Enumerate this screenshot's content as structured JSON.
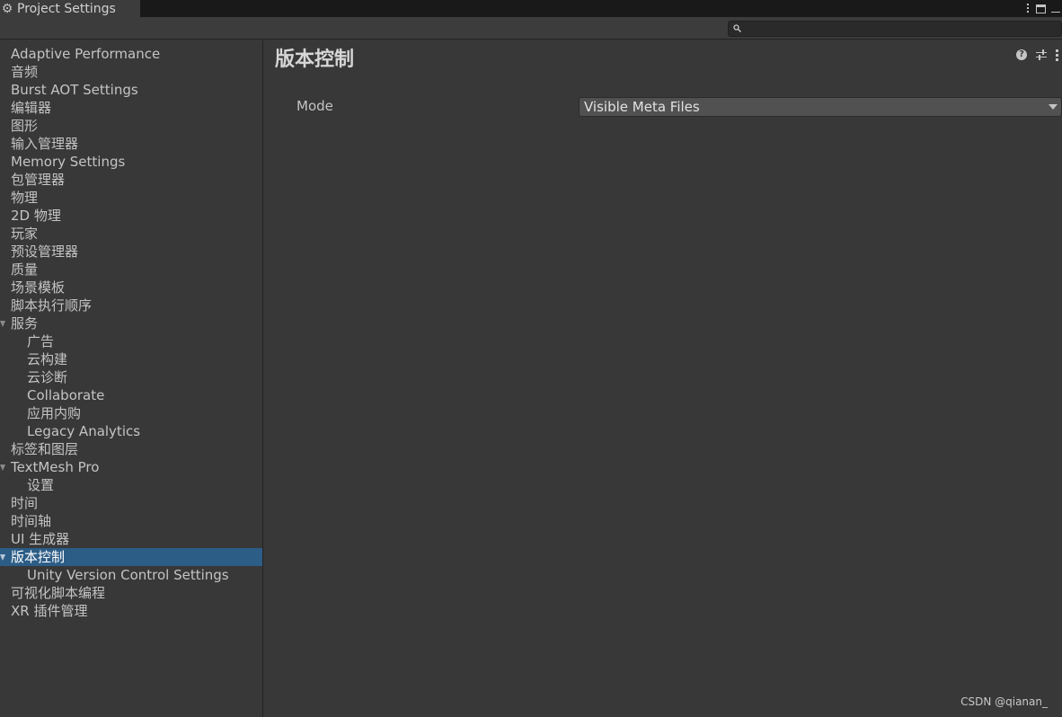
{
  "window": {
    "tab_title": "Project Settings"
  },
  "search": {
    "placeholder": "",
    "value": ""
  },
  "sidebar": {
    "items": [
      {
        "label": "Adaptive Performance",
        "level": 0
      },
      {
        "label": "音频",
        "level": 0
      },
      {
        "label": "Burst AOT Settings",
        "level": 0
      },
      {
        "label": "编辑器",
        "level": 0
      },
      {
        "label": "图形",
        "level": 0
      },
      {
        "label": "输入管理器",
        "level": 0
      },
      {
        "label": "Memory Settings",
        "level": 0
      },
      {
        "label": "包管理器",
        "level": 0
      },
      {
        "label": "物理",
        "level": 0
      },
      {
        "label": "2D 物理",
        "level": 0
      },
      {
        "label": "玩家",
        "level": 0
      },
      {
        "label": "预设管理器",
        "level": 0
      },
      {
        "label": "质量",
        "level": 0
      },
      {
        "label": "场景模板",
        "level": 0
      },
      {
        "label": "脚本执行顺序",
        "level": 0
      },
      {
        "label": "服务",
        "level": 0,
        "expanded": true
      },
      {
        "label": "广告",
        "level": 1
      },
      {
        "label": "云构建",
        "level": 1
      },
      {
        "label": "云诊断",
        "level": 1
      },
      {
        "label": "Collaborate",
        "level": 1
      },
      {
        "label": "应用内购",
        "level": 1
      },
      {
        "label": "Legacy Analytics",
        "level": 1
      },
      {
        "label": "标签和图层",
        "level": 0
      },
      {
        "label": "TextMesh Pro",
        "level": 0,
        "expanded": true
      },
      {
        "label": "设置",
        "level": 1
      },
      {
        "label": "时间",
        "level": 0
      },
      {
        "label": "时间轴",
        "level": 0
      },
      {
        "label": "UI 生成器",
        "level": 0
      },
      {
        "label": "版本控制",
        "level": 0,
        "expanded": true,
        "selected": true
      },
      {
        "label": "Unity Version Control Settings",
        "level": 1
      },
      {
        "label": "可视化脚本编程",
        "level": 0
      },
      {
        "label": "XR 插件管理",
        "level": 0
      }
    ]
  },
  "main": {
    "title": "版本控制",
    "mode_label": "Mode",
    "mode_value": "Visible Meta Files"
  },
  "icons": {
    "header": [
      "help-icon",
      "presets-icon",
      "menu-icon"
    ]
  },
  "colors": {
    "background": "#383838",
    "selection": "#2c5d87",
    "titlebar": "#191919"
  },
  "watermark": "CSDN @qianan_"
}
